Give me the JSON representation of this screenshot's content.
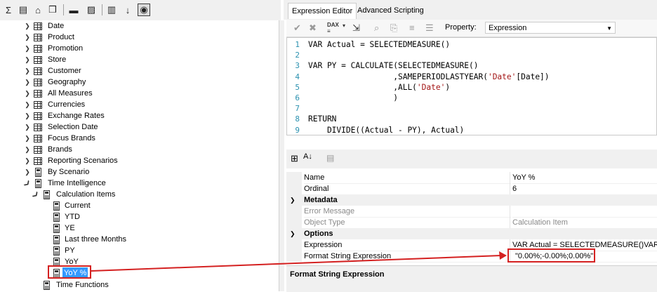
{
  "left_toolbar": {
    "icons": [
      "sigma-icon",
      "column-icon",
      "hierarchy-icon",
      "cube-icon",
      "folder-icon",
      "hide-icon",
      "columns-icon",
      "sort-az-icon",
      "perspective-icon"
    ]
  },
  "tree": {
    "tables": [
      {
        "label": "Date",
        "icon": "date-table-icon"
      },
      {
        "label": "Product",
        "icon": "table-icon"
      },
      {
        "label": "Promotion",
        "icon": "table-icon"
      },
      {
        "label": "Store",
        "icon": "table-icon"
      },
      {
        "label": "Customer",
        "icon": "table-icon"
      },
      {
        "label": "Geography",
        "icon": "table-icon"
      },
      {
        "label": "All Measures",
        "icon": "table-icon"
      },
      {
        "label": "Currencies",
        "icon": "table-icon"
      },
      {
        "label": "Exchange Rates",
        "icon": "table-icon"
      },
      {
        "label": "Selection Date",
        "icon": "table-icon"
      },
      {
        "label": "Focus Brands",
        "icon": "table-icon"
      },
      {
        "label": "Brands",
        "icon": "table-icon"
      },
      {
        "label": "Reporting Scenarios",
        "icon": "table-icon"
      },
      {
        "label": "By Scenario",
        "icon": "calc-group-icon"
      },
      {
        "label": "Time Intelligence",
        "icon": "calc-group-icon"
      }
    ],
    "calc_items_folder": "Calculation Items",
    "calc_items": [
      "Current",
      "YTD",
      "YE",
      "Last three Months",
      "PY",
      "YoY",
      "YoY %"
    ],
    "selected_item": "YoY %",
    "after": "Time Functions"
  },
  "tabs": {
    "expression_editor": "Expression Editor",
    "advanced_scripting": "Advanced Scripting"
  },
  "expr_toolbar": {
    "property_label": "Property:",
    "property_value": "Expression"
  },
  "editor": {
    "lines": [
      {
        "n": "1",
        "text": "VAR Actual = SELECTEDMEASURE()"
      },
      {
        "n": "2",
        "text": ""
      },
      {
        "n": "3",
        "text": "VAR PY = CALCULATE(SELECTEDMEASURE()"
      },
      {
        "n": "4",
        "text": "                  ,SAMEPERIODLASTYEAR('Date'[Date])"
      },
      {
        "n": "5",
        "text": "                  ,ALL('Date')"
      },
      {
        "n": "6",
        "text": "                  )"
      },
      {
        "n": "7",
        "text": ""
      },
      {
        "n": "8",
        "text": "RETURN"
      },
      {
        "n": "9",
        "text": "    DIVIDE((Actual - PY), Actual)"
      }
    ]
  },
  "properties": {
    "name_label": "Name",
    "name_value": "YoY %",
    "ordinal_label": "Ordinal",
    "ordinal_value": "6",
    "metadata_cat": "Metadata",
    "error_label": "Error Message",
    "error_value": "",
    "objtype_label": "Object Type",
    "objtype_value": "Calculation Item",
    "options_cat": "Options",
    "expression_label": "Expression",
    "expression_value": "VAR Actual = SELECTEDMEASURE()VAR",
    "fse_label": "Format String Expression",
    "fse_value": "\"0.00%;-0.00%;0.00%\""
  },
  "description": {
    "title": "Format String Expression"
  },
  "colors": {
    "annotation": "#d42020",
    "selection": "#3399ff",
    "line_number": "#2b91af"
  }
}
